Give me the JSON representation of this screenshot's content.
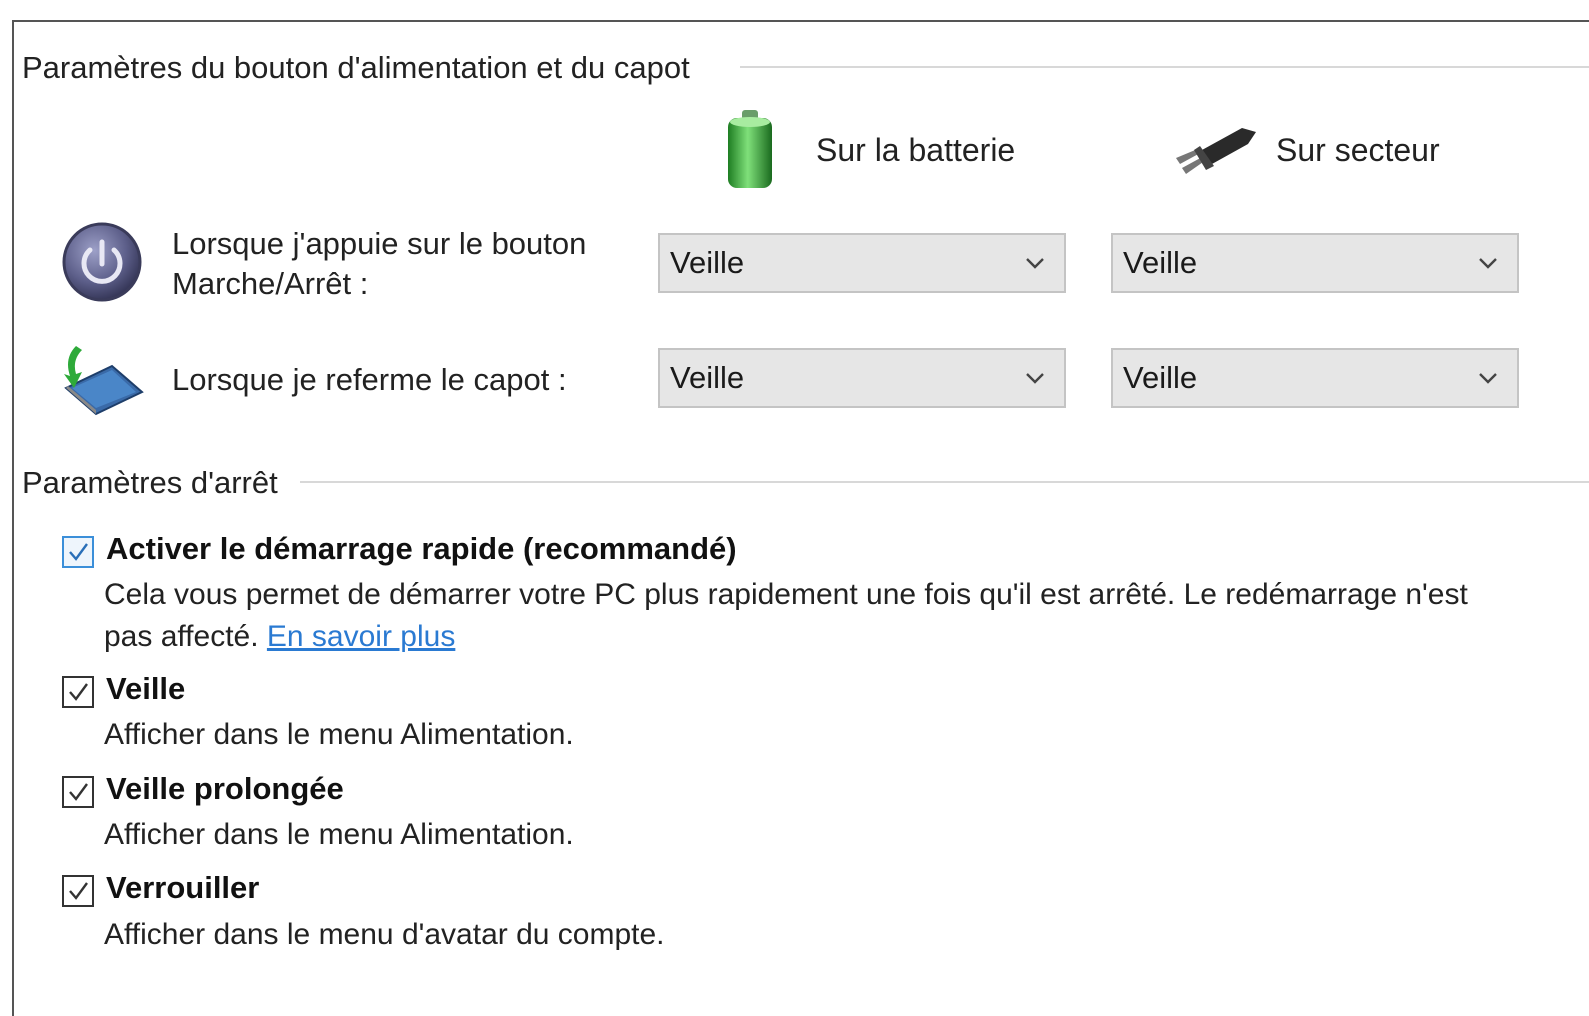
{
  "power_button_group": {
    "title": "Paramètres du bouton d'alimentation et du capot",
    "columns": {
      "battery": "Sur la batterie",
      "ac": "Sur secteur"
    },
    "rows": [
      {
        "label_line1": "Lorsque j'appuie sur le bouton",
        "label_line2": "Marche/Arrêt :",
        "battery_value": "Veille",
        "ac_value": "Veille",
        "icon": "power-button-icon"
      },
      {
        "label_line1": "Lorsque je referme le capot :",
        "battery_value": "Veille",
        "ac_value": "Veille",
        "icon": "laptop-lid-icon"
      }
    ]
  },
  "shutdown_group": {
    "title": "Paramètres d'arrêt",
    "options": [
      {
        "label": "Activer le démarrage rapide (recommandé)",
        "desc_line1": "Cela vous permet de démarrer votre PC plus rapidement une fois qu'il est arrêté. Le redémarrage n'est",
        "desc_line2": "pas affecté.",
        "link": "En savoir plus",
        "checked": true
      },
      {
        "label": "Veille",
        "desc": "Afficher dans le menu Alimentation.",
        "checked": true
      },
      {
        "label": "Veille prolongée",
        "desc": "Afficher dans le menu Alimentation.",
        "checked": true
      },
      {
        "label": "Verrouiller",
        "desc": "Afficher dans le menu d'avatar du compte.",
        "checked": true
      }
    ]
  },
  "colors": {
    "accent": "#3b8fd9",
    "link": "#2a7ad2",
    "select_bg": "#e6e6e6",
    "battery_green": "#3aa53a"
  }
}
